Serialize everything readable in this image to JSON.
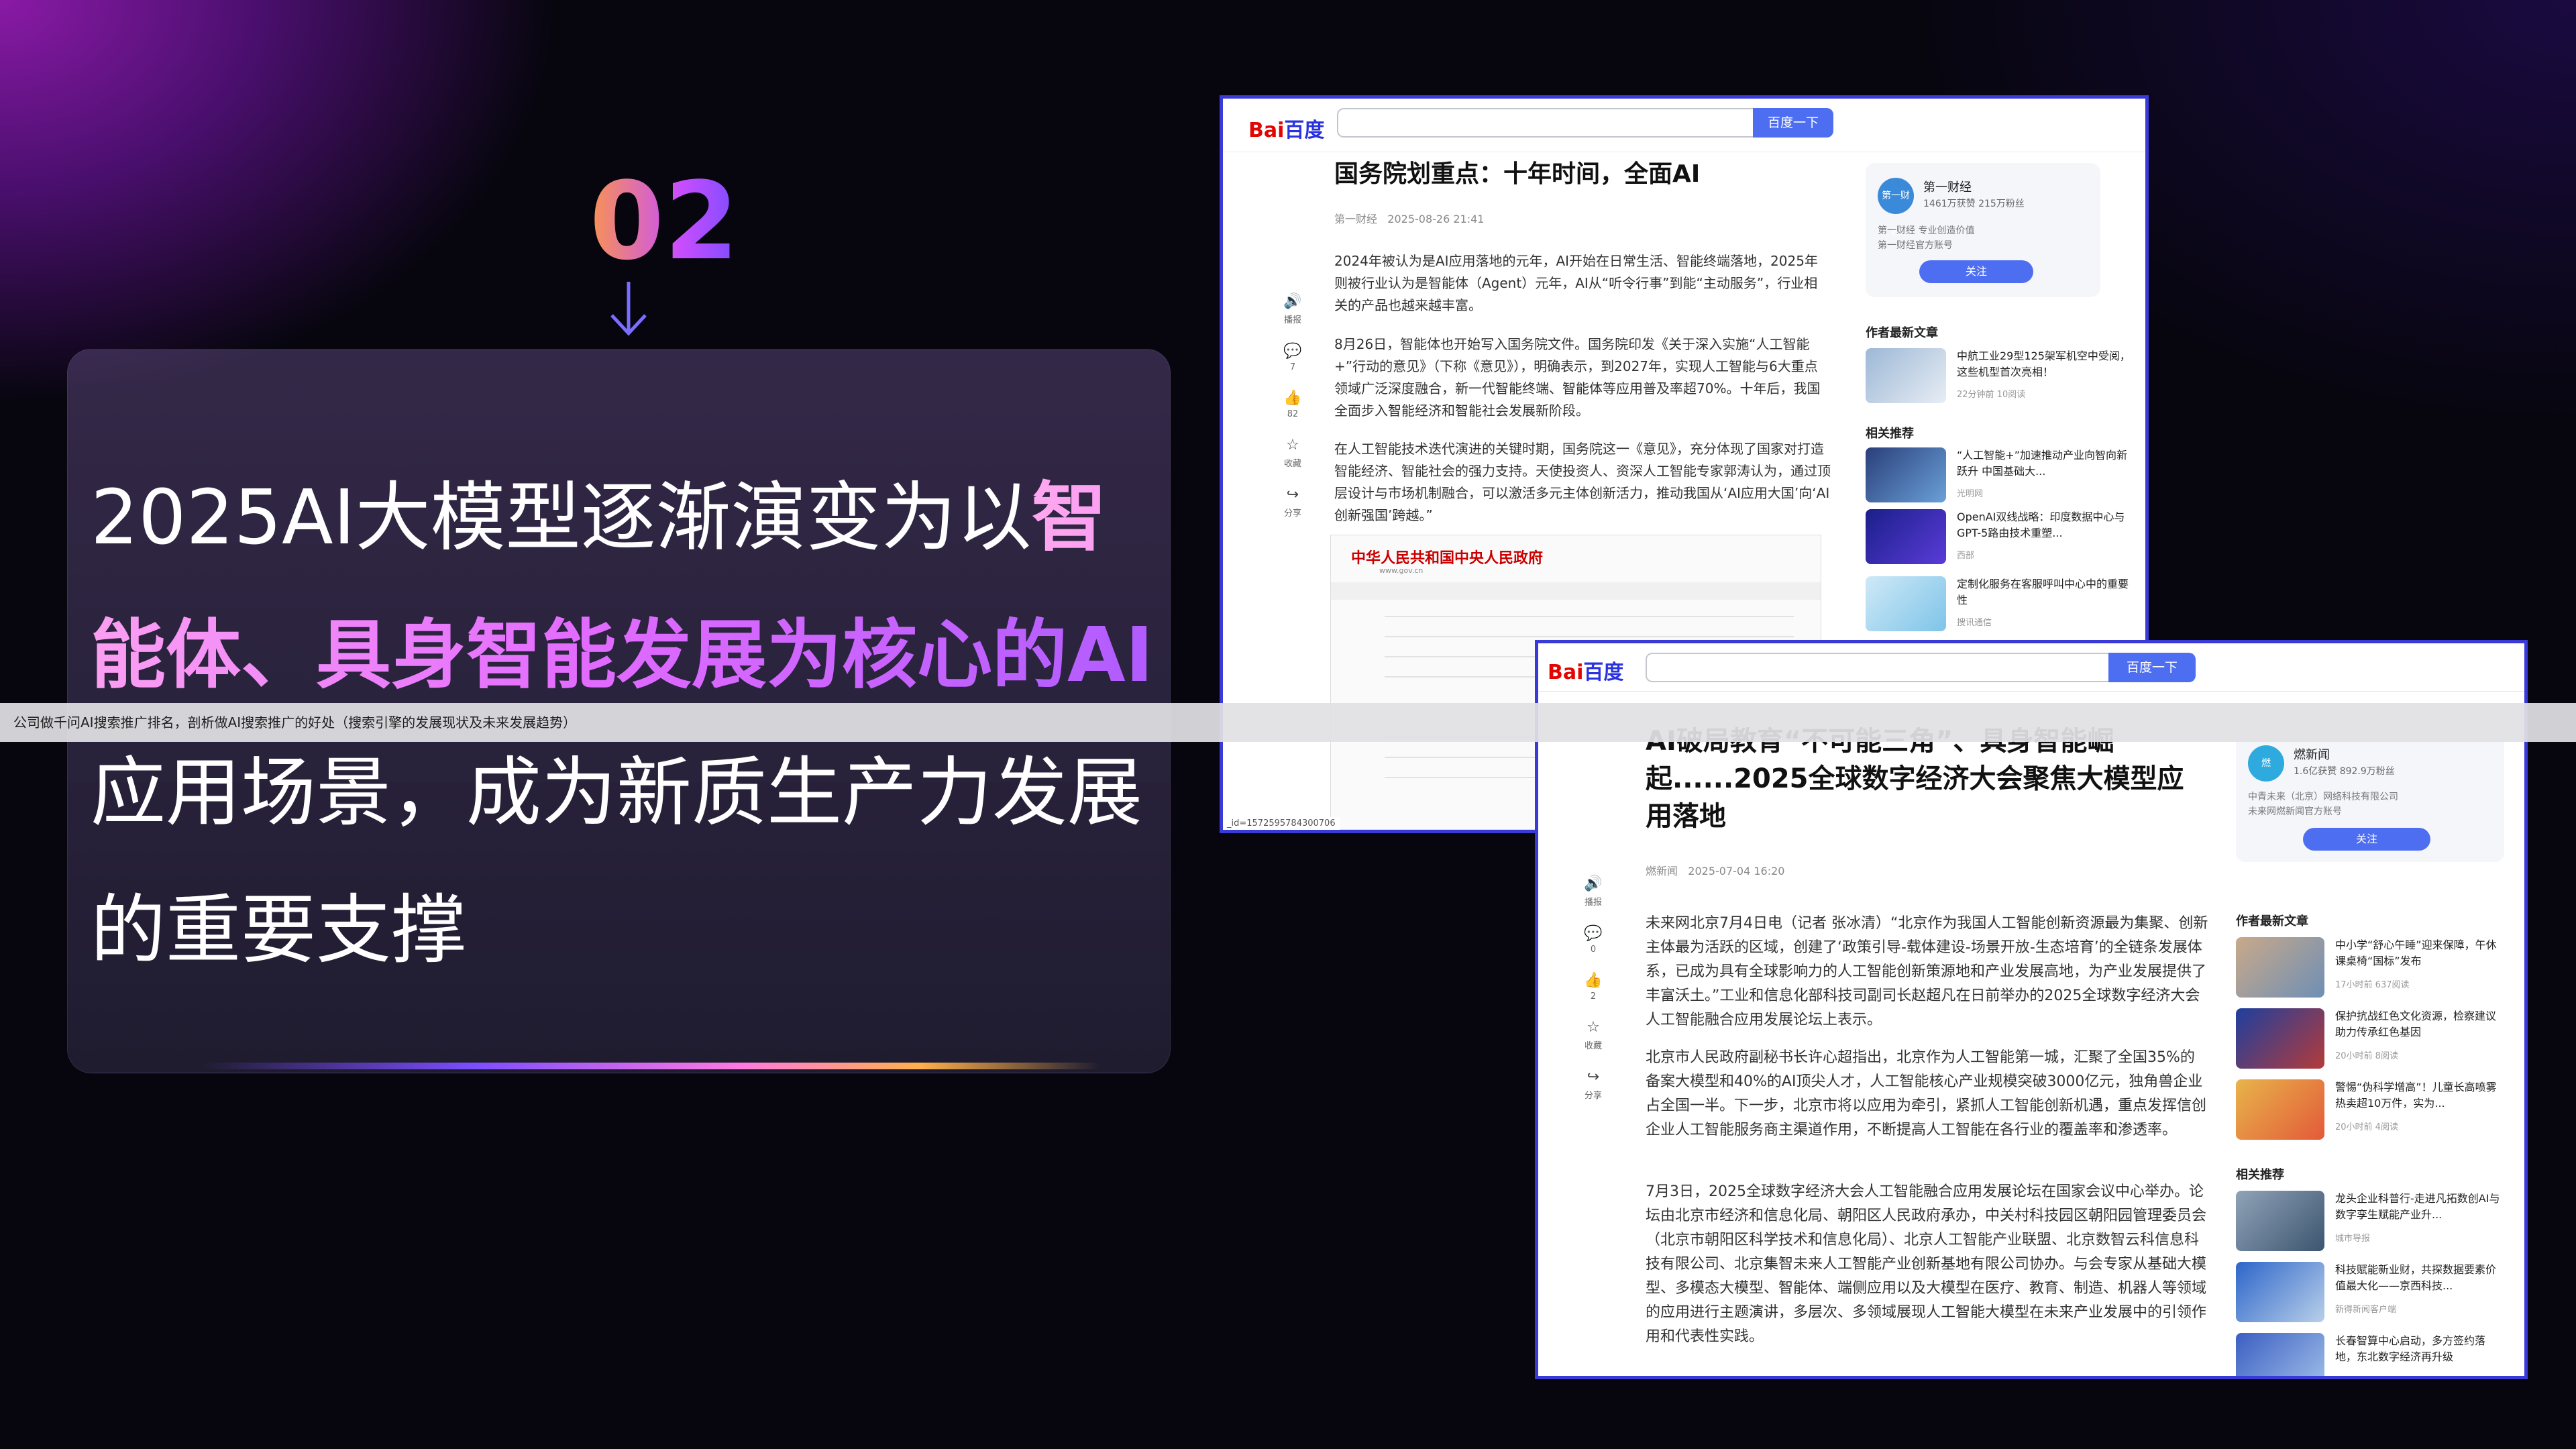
{
  "slide": {
    "number": "02",
    "headline_parts": [
      {
        "text": "2025AI大模型逐渐演变为以",
        "highlight": false
      },
      {
        "text": "智能体、具身智能发展为核心的AI",
        "highlight": true
      },
      {
        "text": "应用场景，成为新质生产力发展的重要支撑",
        "highlight": false
      }
    ]
  },
  "banner": {
    "text": "公司做千问AI搜索推广排名，剖析做AI搜索推广的好处（搜索引擎的发展现状及未来发展趋势）"
  },
  "shot1": {
    "logo_a": "Bai",
    "logo_b": "百度",
    "search_button": "百度一下",
    "title": "国务院划重点：十年时间，全面AI",
    "source": "第一财经",
    "date": "2025-08-26 21:41",
    "paragraphs": [
      "2024年被认为是AI应用落地的元年，AI开始在日常生活、智能终端落地，2025年则被行业认为是智能体（Agent）元年，AI从“听令行事”到能“主动服务”，行业相关的产品也越来越丰富。",
      "8月26日，智能体也开始写入国务院文件。国务院印发《关于深入实施“人工智能+”行动的意见》（下称《意见》），明确表示，到2027年，实现人工智能与6大重点领域广泛深度融合，新一代智能终端、智能体等应用普及率超70%。十年后，我国全面步入智能经济和智能社会发展新阶段。",
      "在人工智能技术迭代演进的关键时期，国务院这一《意见》，充分体现了国家对打造智能经济、智能社会的强力支持。天使投资人、资深人工智能专家郭涛认为，通过顶层设计与市场机制融合，可以激活多元主体创新活力，推动我国从‘AI应用大国’向‘AI创新强国’跨越。”"
    ],
    "side_actions": [
      {
        "icon": "🔊",
        "label": "播报"
      },
      {
        "icon": "💬",
        "label": "7"
      },
      {
        "icon": "👍",
        "label": "82"
      },
      {
        "icon": "☆",
        "label": "收藏"
      },
      {
        "icon": "↪",
        "label": "分享"
      }
    ],
    "author": {
      "avatar_text": "第一财经",
      "name": "第一财经",
      "fans": "1461万获赞 215万粉丝",
      "desc1": "第一财经 专业创造价值",
      "desc2": "第一财经官方账号",
      "follow": "关注"
    },
    "sec_author_articles": "作者最新文章",
    "author_articles": [
      {
        "title": "中航工业29型125架军机空中受阅，这些机型首次亮相！",
        "meta": "22分钟前   10阅读"
      }
    ],
    "sec_related": "相关推荐",
    "related": [
      {
        "title": "“人工智能+”加速推动产业向智向新跃升 中国基础大...",
        "meta": "光明网"
      },
      {
        "title": "OpenAI双线战略：印度数据中心与GPT-5路由技术重塑...",
        "meta": "西部"
      },
      {
        "title": "定制化服务在客服呼叫中心中的重要性",
        "meta": "搜讯通信"
      }
    ],
    "embed": {
      "gov_title": "中华人民共和国中央人民政府",
      "gov_url": "www.gov.cn"
    },
    "url_footer": "_id=1572595784300706"
  },
  "shot2": {
    "logo_a": "Bai",
    "logo_b": "百度",
    "search_button": "百度一下",
    "title": "AI破局教育“不可能三角”、具身智能崛起......2025全球数字经济大会聚焦大模型应用落地",
    "source": "燃新闻",
    "date": "2025-07-04 16:20",
    "paragraphs": [
      "未来网北京7月4日电（记者 张冰清）“北京作为我国人工智能创新资源最为集聚、创新主体最为活跃的区域，创建了‘政策引导-载体建设-场景开放-生态培育’的全链条发展体系，已成为具有全球影响力的人工智能创新策源地和产业发展高地，为产业发展提供了丰富沃土。”工业和信息化部科技司副司长赵超凡在日前举办的2025全球数字经济大会人工智能融合应用发展论坛上表示。",
      "北京市人民政府副秘书长许心超指出，北京作为人工智能第一城，汇聚了全国35%的备案大模型和40%的AI顶尖人才，人工智能核心产业规模突破3000亿元，独角兽企业占全国一半。下一步，北京市将以应用为牵引，紧抓人工智能创新机遇，重点发挥信创企业人工智能服务商主渠道作用，不断提高人工智能在各行业的覆盖率和渗透率。",
      "7月3日，2025全球数字经济大会人工智能融合应用发展论坛在国家会议中心举办。论坛由北京市经济和信息化局、朝阳区人民政府承办，中关村科技园区朝阳园管理委员会（北京市朝阳区科学技术和信息化局）、北京人工智能产业联盟、北京数智云科信息科技有限公司、北京集智未来人工智能产业创新基地有限公司协办。与会专家从基础大模型、多模态大模型、智能体、端侧应用以及大模型在医疗、教育、制造、机器人等领域的应用进行主题演讲，多层次、多领域展现人工智能大模型在未来产业发展中的引领作用和代表性实践。"
    ],
    "side_actions": [
      {
        "icon": "🔊",
        "label": "播报"
      },
      {
        "icon": "💬",
        "label": "0"
      },
      {
        "icon": "👍",
        "label": "2"
      },
      {
        "icon": "☆",
        "label": "收藏"
      },
      {
        "icon": "↪",
        "label": "分享"
      }
    ],
    "author": {
      "avatar_text": "燃",
      "name": "燃新闻",
      "fans": "1.6亿获赞 892.9万粉丝",
      "desc1": "中青未来（北京）网络科技有限公司",
      "desc2": "未来网燃新闻官方账号",
      "follow": "关注"
    },
    "sec_author_articles": "作者最新文章",
    "author_articles": [
      {
        "title": "中小学“舒心午睡”迎来保障，午休课桌椅“国标”发布",
        "meta": "17小时前   637阅读"
      },
      {
        "title": "保护抗战红色文化资源，检察建议助力传承红色基因",
        "meta": "20小时前   8阅读"
      },
      {
        "title": "警惕“伪科学增高”！儿童长高喷雾热卖超10万件，实为...",
        "meta": "20小时前   4阅读"
      }
    ],
    "sec_related": "相关推荐",
    "related": [
      {
        "title": "龙头企业科普行-走进凡拓数创AI与数字孪生赋能产业升...",
        "meta": "城市导报"
      },
      {
        "title": "科技赋能新业财，共探数据要素价值最大化——京西科技...",
        "meta": "新得新闻客户端"
      },
      {
        "title": "长春智算中心启动，多方签约落地，东北数字经济再升级",
        "meta": ""
      }
    ]
  },
  "colors": {
    "accent_blue": "#4e6ef2",
    "frame_blue": "#3a3ad8",
    "highlight_pink": "#e26bff",
    "baidu_red": "#e10602"
  }
}
